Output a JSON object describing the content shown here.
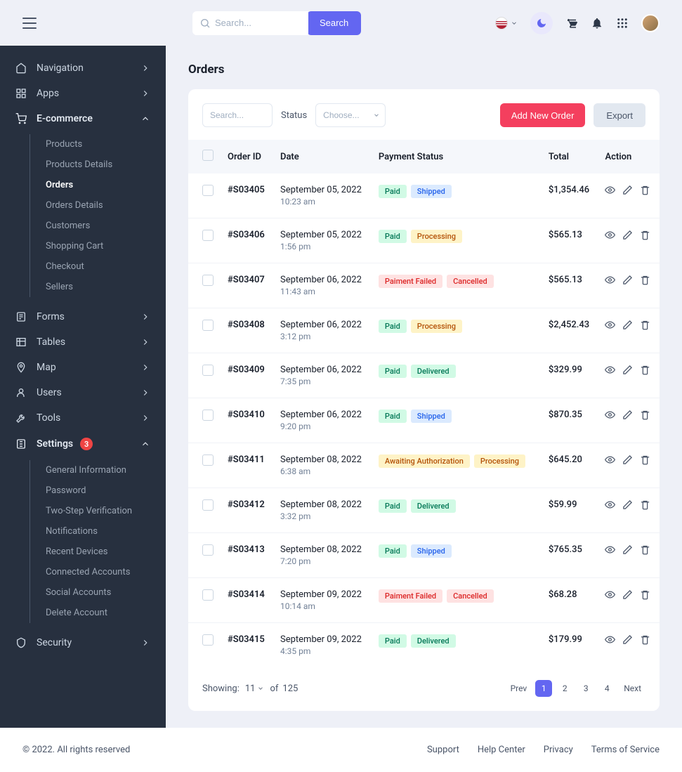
{
  "topbar": {
    "search_placeholder": "Search...",
    "search_button": "Search"
  },
  "sidebar": {
    "groups": [
      {
        "label": "Navigation",
        "icon": "home",
        "expanded": false
      },
      {
        "label": "Apps",
        "icon": "grid",
        "expanded": false
      },
      {
        "label": "E-commerce",
        "icon": "cart",
        "expanded": true,
        "items": [
          {
            "label": "Products"
          },
          {
            "label": "Products Details"
          },
          {
            "label": "Orders",
            "active": true
          },
          {
            "label": "Orders Details"
          },
          {
            "label": "Customers"
          },
          {
            "label": "Shopping Cart"
          },
          {
            "label": "Checkout"
          },
          {
            "label": "Sellers"
          }
        ]
      },
      {
        "label": "Forms",
        "icon": "form",
        "expanded": false
      },
      {
        "label": "Tables",
        "icon": "table",
        "expanded": false
      },
      {
        "label": "Map",
        "icon": "pin",
        "expanded": false
      },
      {
        "label": "Users",
        "icon": "user",
        "expanded": false
      },
      {
        "label": "Tools",
        "icon": "wrench",
        "expanded": false
      },
      {
        "label": "Settings",
        "icon": "settings",
        "expanded": true,
        "badge": "3",
        "items": [
          {
            "label": "General Information"
          },
          {
            "label": "Password"
          },
          {
            "label": "Two-Step Verification"
          },
          {
            "label": "Notifications"
          },
          {
            "label": "Recent Devices"
          },
          {
            "label": "Connected Accounts"
          },
          {
            "label": "Social Accounts"
          },
          {
            "label": "Delete Account"
          }
        ]
      },
      {
        "label": "Security",
        "icon": "shield",
        "expanded": false
      }
    ]
  },
  "page": {
    "title": "Orders",
    "filter_search_placeholder": "Search...",
    "filter_status_label": "Status",
    "filter_status_placeholder": "Choose...",
    "add_button": "Add New Order",
    "export_button": "Export",
    "columns": {
      "order_id": "Order ID",
      "date": "Date",
      "payment_status": "Payment Status",
      "total": "Total",
      "action": "Action"
    },
    "rows": [
      {
        "id": "#S03405",
        "date": "September 05, 2022",
        "time": "10:23 am",
        "status": [
          {
            "t": "Paid",
            "c": "green"
          },
          {
            "t": "Shipped",
            "c": "blue"
          }
        ],
        "total": "$1,354.46"
      },
      {
        "id": "#S03406",
        "date": "September 05, 2022",
        "time": "1:56 pm",
        "status": [
          {
            "t": "Paid",
            "c": "green"
          },
          {
            "t": "Processing",
            "c": "yellow"
          }
        ],
        "total": "$565.13"
      },
      {
        "id": "#S03407",
        "date": "September 06, 2022",
        "time": "11:43 am",
        "status": [
          {
            "t": "Paiment Failed",
            "c": "red"
          },
          {
            "t": "Cancelled",
            "c": "red"
          }
        ],
        "total": "$565.13"
      },
      {
        "id": "#S03408",
        "date": "September 06, 2022",
        "time": "3:12 pm",
        "status": [
          {
            "t": "Paid",
            "c": "green"
          },
          {
            "t": "Processing",
            "c": "yellow"
          }
        ],
        "total": "$2,452.43"
      },
      {
        "id": "#S03409",
        "date": "September 06, 2022",
        "time": "7:35 pm",
        "status": [
          {
            "t": "Paid",
            "c": "green"
          },
          {
            "t": "Delivered",
            "c": "green"
          }
        ],
        "total": "$329.99"
      },
      {
        "id": "#S03410",
        "date": "September 06, 2022",
        "time": "9:20 pm",
        "status": [
          {
            "t": "Paid",
            "c": "green"
          },
          {
            "t": "Shipped",
            "c": "blue"
          }
        ],
        "total": "$870.35"
      },
      {
        "id": "#S03411",
        "date": "September 08, 2022",
        "time": "6:38 am",
        "status": [
          {
            "t": "Awaiting Authorization",
            "c": "yellow"
          },
          {
            "t": "Processing",
            "c": "yellow"
          }
        ],
        "total": "$645.20"
      },
      {
        "id": "#S03412",
        "date": "September 08, 2022",
        "time": "3:32 pm",
        "status": [
          {
            "t": "Paid",
            "c": "green"
          },
          {
            "t": "Delivered",
            "c": "green"
          }
        ],
        "total": "$59.99"
      },
      {
        "id": "#S03413",
        "date": "September 08, 2022",
        "time": "7:20 pm",
        "status": [
          {
            "t": "Paid",
            "c": "green"
          },
          {
            "t": "Shipped",
            "c": "blue"
          }
        ],
        "total": "$765.35"
      },
      {
        "id": "#S03414",
        "date": "September 09, 2022",
        "time": "10:14 am",
        "status": [
          {
            "t": "Paiment Failed",
            "c": "red"
          },
          {
            "t": "Cancelled",
            "c": "red"
          }
        ],
        "total": "$68.28"
      },
      {
        "id": "#S03415",
        "date": "September 09, 2022",
        "time": "4:35 pm",
        "status": [
          {
            "t": "Paid",
            "c": "green"
          },
          {
            "t": "Delivered",
            "c": "green"
          }
        ],
        "total": "$179.99"
      }
    ],
    "pagination": {
      "showing_label": "Showing:",
      "per_page": "11",
      "of_label": "of",
      "total": "125",
      "prev": "Prev",
      "next": "Next",
      "pages": [
        "1",
        "2",
        "3",
        "4"
      ],
      "current": "1"
    }
  },
  "footer": {
    "copyright": "© 2022. All rights reserved",
    "links": [
      "Support",
      "Help Center",
      "Privacy",
      "Terms of Service"
    ]
  }
}
